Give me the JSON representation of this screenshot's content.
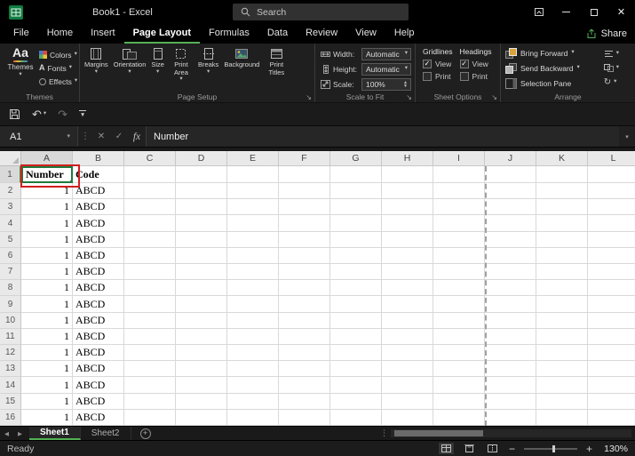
{
  "title_bar": {
    "app_title": "Book1 - Excel",
    "search_placeholder": "Search"
  },
  "ribbon": {
    "tabs": [
      "File",
      "Home",
      "Insert",
      "Page Layout",
      "Formulas",
      "Data",
      "Review",
      "View",
      "Help"
    ],
    "active_tab": "Page Layout",
    "share_label": "Share",
    "themes_group": {
      "label": "Themes",
      "themes_button": "Themes",
      "colors_button": "Colors",
      "fonts_button": "Fonts",
      "effects_button": "Effects"
    },
    "page_setup_group": {
      "label": "Page Setup",
      "buttons": [
        "Margins",
        "Orientation",
        "Size",
        "Print Area",
        "Breaks",
        "Background",
        "Print Titles"
      ]
    },
    "scale_group": {
      "label": "Scale to Fit",
      "width_label": "Width:",
      "width_value": "Automatic",
      "height_label": "Height:",
      "height_value": "Automatic",
      "scale_label": "Scale:",
      "scale_value": "100%"
    },
    "sheet_options_group": {
      "label": "Sheet Options",
      "gridlines_header": "Gridlines",
      "headings_header": "Headings",
      "view_label": "View",
      "print_label": "Print",
      "gridlines_view_checked": true,
      "gridlines_print_checked": false,
      "headings_view_checked": true,
      "headings_print_checked": false
    },
    "arrange_group": {
      "label": "Arrange",
      "buttons": [
        "Bring Forward",
        "Send Backward",
        "Selection Pane"
      ]
    }
  },
  "formula_bar": {
    "name_box": "A1",
    "fx_label": "fx",
    "content": "Number"
  },
  "grid": {
    "columns": [
      "A",
      "B",
      "C",
      "D",
      "E",
      "F",
      "G",
      "H",
      "I",
      "J",
      "K",
      "L"
    ],
    "selected_column": "A",
    "selected_row": "1",
    "page_break_after_column": "I",
    "rows": [
      {
        "n": "1",
        "a": "Number",
        "b": "Code"
      },
      {
        "n": "2",
        "a": "1",
        "b": "ABCD"
      },
      {
        "n": "3",
        "a": "1",
        "b": "ABCD"
      },
      {
        "n": "4",
        "a": "1",
        "b": "ABCD"
      },
      {
        "n": "5",
        "a": "1",
        "b": "ABCD"
      },
      {
        "n": "6",
        "a": "1",
        "b": "ABCD"
      },
      {
        "n": "7",
        "a": "1",
        "b": "ABCD"
      },
      {
        "n": "8",
        "a": "1",
        "b": "ABCD"
      },
      {
        "n": "9",
        "a": "1",
        "b": "ABCD"
      },
      {
        "n": "10",
        "a": "1",
        "b": "ABCD"
      },
      {
        "n": "11",
        "a": "1",
        "b": "ABCD"
      },
      {
        "n": "12",
        "a": "1",
        "b": "ABCD"
      },
      {
        "n": "13",
        "a": "1",
        "b": "ABCD"
      },
      {
        "n": "14",
        "a": "1",
        "b": "ABCD"
      },
      {
        "n": "15",
        "a": "1",
        "b": "ABCD"
      },
      {
        "n": "16",
        "a": "1",
        "b": "ABCD"
      }
    ]
  },
  "sheet_tabs": {
    "tabs": [
      "Sheet1",
      "Sheet2"
    ],
    "active": "Sheet1"
  },
  "status_bar": {
    "status": "Ready",
    "zoom": "130%"
  },
  "colors": {
    "accent_green": "#54b054",
    "selection_green": "#1f7a3c",
    "annotation_red": "#d21f1f"
  }
}
